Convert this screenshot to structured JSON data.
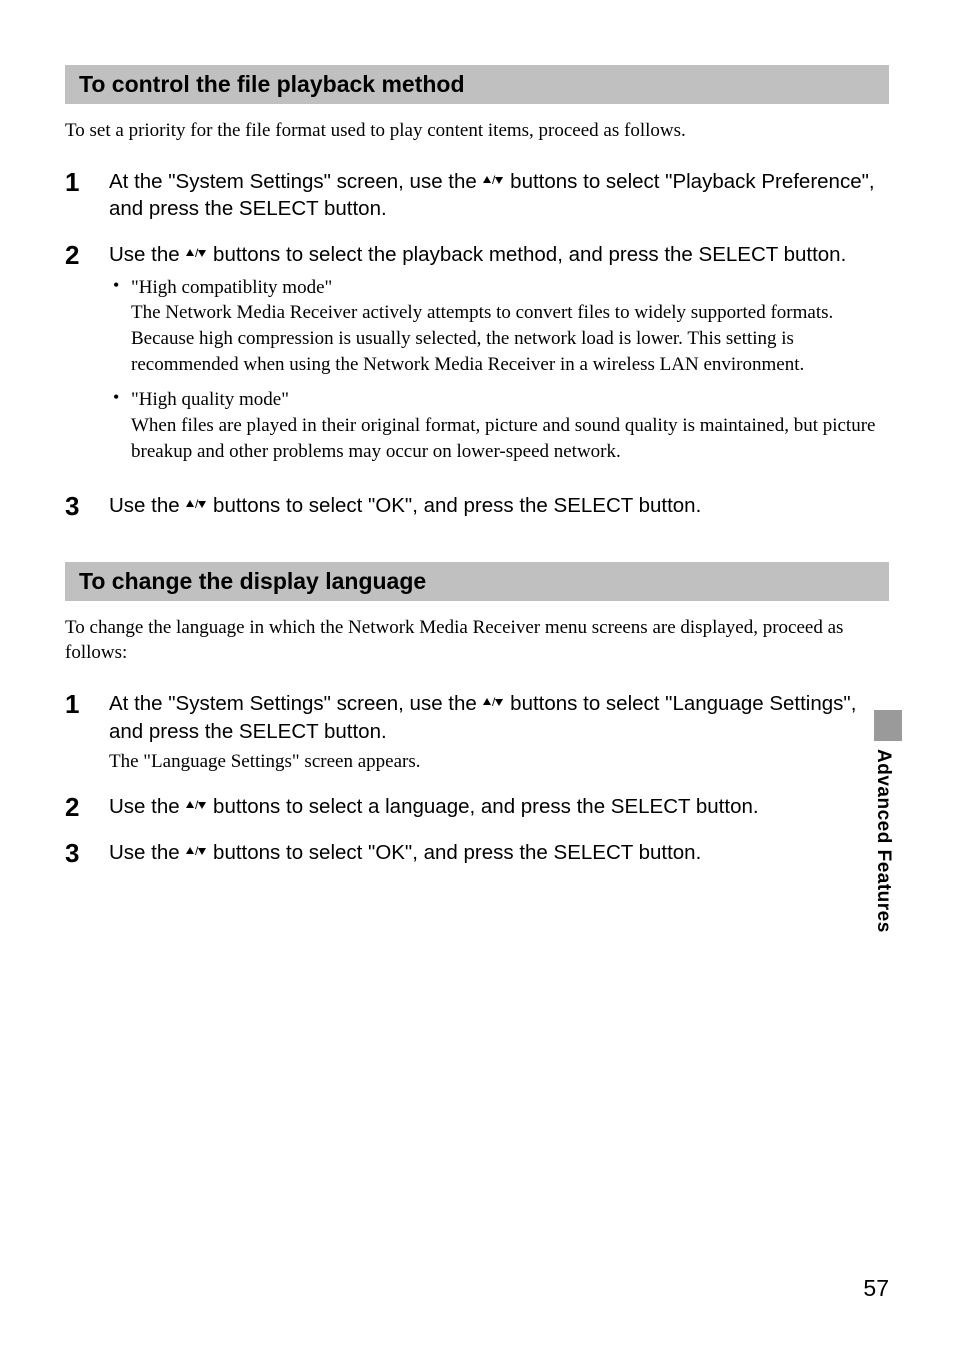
{
  "section1": {
    "title": "To control the file playback method",
    "intro": "To set a priority for the file format used to play content items, proceed as follows.",
    "steps": {
      "s1": {
        "num": "1",
        "main_a": "At the \"System Settings\" screen, use the ",
        "main_b": " buttons to select \"Playback Preference\", and press the SELECT button."
      },
      "s2": {
        "num": "2",
        "main_a": "Use the ",
        "main_b": " buttons to select the playback method, and press the SELECT button.",
        "bullets": {
          "b1": {
            "title": "\"High compatiblity mode\"",
            "desc": "The Network Media Receiver actively attempts to convert files to widely supported formats. Because high compression is usually selected, the network load is lower. This setting is recommended when using the Network Media Receiver in a wireless LAN environment."
          },
          "b2": {
            "title": "\"High quality mode\"",
            "desc": "When files are played in their original format, picture and sound quality is maintained, but picture breakup and other problems may occur on lower-speed network."
          }
        }
      },
      "s3": {
        "num": "3",
        "main_a": "Use the ",
        "main_b": " buttons to select \"OK\", and press the SELECT button."
      }
    }
  },
  "section2": {
    "title": "To change the display language",
    "intro": "To change the language in which the Network Media Receiver menu screens are displayed, proceed as follows:",
    "steps": {
      "s1": {
        "num": "1",
        "main_a": "At the \"System Settings\" screen, use the ",
        "main_b": " buttons to select \"Language Settings\", and press the SELECT button.",
        "sub": "The \"Language Settings\" screen appears."
      },
      "s2": {
        "num": "2",
        "main_a": "Use the ",
        "main_b": " buttons to select a language, and press the SELECT button."
      },
      "s3": {
        "num": "3",
        "main_a": "Use the ",
        "main_b": " buttons to select \"OK\", and press the SELECT button."
      }
    }
  },
  "sideTab": "Advanced Features",
  "pageNumber": "57",
  "arrowGlyph": "♠/♣"
}
